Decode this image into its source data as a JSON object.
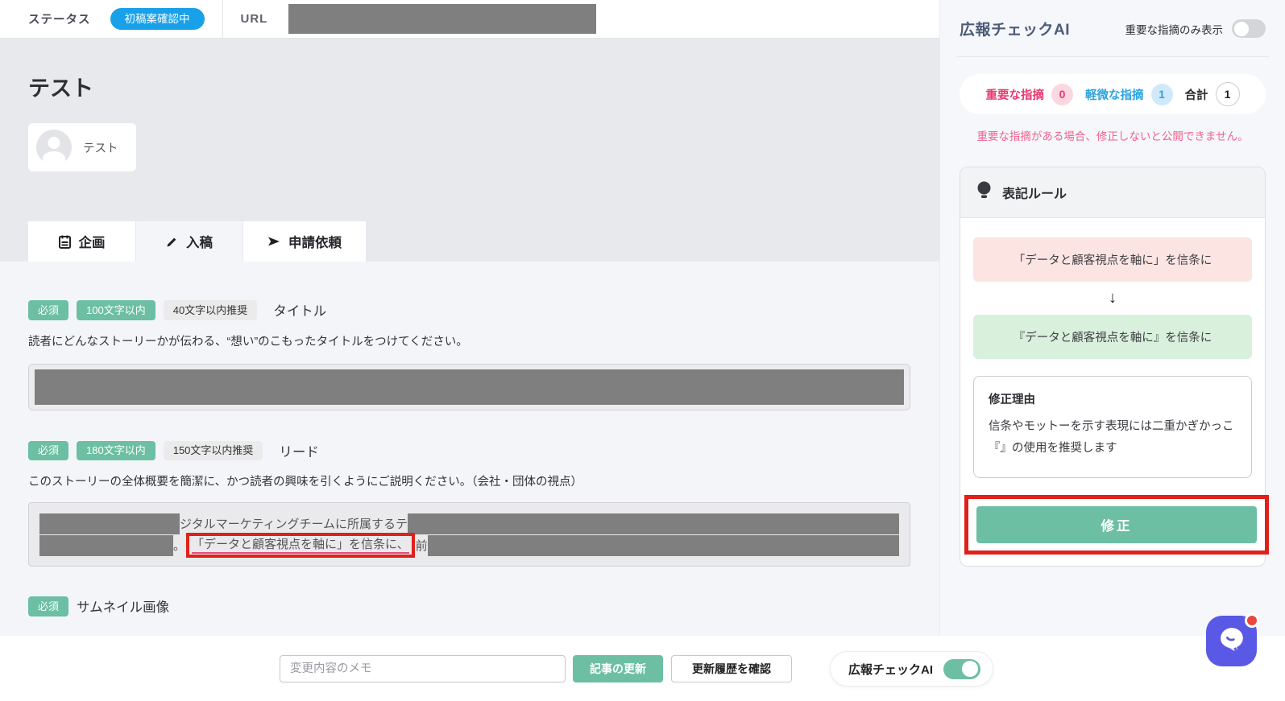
{
  "topbar": {
    "status_label": "ステータス",
    "status_value": "初稿案確認中",
    "url_label": "URL"
  },
  "header": {
    "page_title": "テスト",
    "author_name": "テスト"
  },
  "tabs": [
    {
      "label": "企画",
      "icon": "clipboard-icon",
      "active": false
    },
    {
      "label": "入稿",
      "icon": "pencil-icon",
      "active": true
    },
    {
      "label": "申請依頼",
      "icon": "send-icon",
      "active": false
    }
  ],
  "form": {
    "title_field": {
      "badge_required": "必須",
      "badge_limit": "100文字以内",
      "badge_recommend": "40文字以内推奨",
      "label": "タイトル",
      "help": "読者にどんなストーリーかが伝わる、“想い”のこもったタイトルをつけてください。"
    },
    "lead_field": {
      "badge_required": "必須",
      "badge_limit": "180文字以内",
      "badge_recommend": "150文字以内推奨",
      "label": "リード",
      "help": "このストーリーの全体概要を簡潔に、かつ読者の興味を引くようにご説明ください。（会社・団体の視点）",
      "visible_line1": "ジタルマーケティングチームに所属するテ",
      "line2_prefix": "。",
      "highlighted_text": "「データと顧客視点を軸に」を信条に、",
      "line2_suffix": "前"
    },
    "thumbnail_field": {
      "badge_required": "必須",
      "label": "サムネイル画像"
    }
  },
  "footer": {
    "memo_placeholder": "変更内容のメモ",
    "update_button": "記事の更新",
    "history_button": "更新履歴を確認",
    "ai_toggle_label": "広報チェックAI",
    "ai_toggle_state": "on"
  },
  "ai_panel": {
    "title": "広報チェックAI",
    "filter_toggle_label": "重要な指摘のみ表示",
    "filter_toggle_state": "off",
    "stats": [
      {
        "label": "重要な指摘",
        "count": "0",
        "color": "pink"
      },
      {
        "label": "軽微な指摘",
        "count": "1",
        "color": "blue"
      },
      {
        "label": "合計",
        "count": "1",
        "color": "neutral"
      }
    ],
    "warning": "重要な指摘がある場合、修正しないと公開できません。",
    "rule_card": {
      "title": "表記ルール",
      "icon": "lightbulb-icon",
      "before_text": "「データと顧客視点を軸に」を信条に",
      "arrow": "↓",
      "after_text": "『データと顧客視点を軸に』を信条に",
      "reason_title": "修正理由",
      "reason_text": "信条やモットーを示す表現には二重かぎかっこ『』の使用を推奨します",
      "fix_button": "修正"
    }
  },
  "colors": {
    "status_blue": "#18a0e9",
    "accent_teal": "#6cbfa3",
    "alert_pink": "#e73a70",
    "info_blue": "#2aa3de",
    "highlight_red": "#e0211a",
    "before_bg": "#fce4e2",
    "after_bg": "#d8f0dc",
    "chat_indigo": "#5a59e6"
  }
}
